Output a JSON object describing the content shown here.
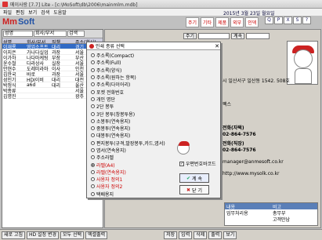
{
  "window": {
    "title": "메이사랑 [7.7] Lite - [c:\\MoSoft\\db\\2006\\mainmlm.mdb]"
  },
  "menu": [
    "파일",
    "편집",
    "보기",
    "검색",
    "도움말"
  ],
  "date_text": "2015년 3월 23일 월요일",
  "logo": {
    "mm": "Mm",
    "rest": "Soft"
  },
  "topnav": [
    "주기",
    "기타",
    "제품",
    "외부",
    "인덱"
  ],
  "toolbar_icons": [
    "Q",
    "P",
    "X",
    "S",
    "?"
  ],
  "left_panel": {
    "search_fields": [
      "성명",
      "회사/부서",
      "검색"
    ],
    "columns": [
      "성명",
      "회사/부서",
      "직책",
      "주소(회사)"
    ],
    "rows": [
      [
        "이재룡",
        "영업소프트",
        "대리",
        "경기"
      ],
      [
        "이지은",
        "가나다실업",
        "과장",
        "서울"
      ],
      [
        "이가하",
        "나다마케팅",
        "부장",
        "부산"
      ],
      [
        "윤수철",
        "다라상사",
        "실장",
        "서울"
      ],
      [
        "안현수",
        "도레미라마",
        "이사",
        "인천"
      ],
      [
        "김한국",
        "바로",
        "과장",
        "서울"
      ],
      [
        "성인기",
        "HDI이비",
        "대리",
        "대전"
      ],
      [
        "박정식",
        "a6d",
        "대리",
        "울산"
      ],
      [
        "박종류",
        "",
        "",
        "서울"
      ],
      [
        "김명진",
        "",
        "",
        "광주"
      ]
    ],
    "selected_row": 0
  },
  "right_panel": {
    "top_buttons": [
      "주기",
      "계속",
      "비고"
    ],
    "fax_label": "팩스",
    "phone_work_label": "전화(자택)",
    "phone_work_value": "02-864-7576",
    "phone_home_label": "전화(직장)",
    "phone_mobile_value": "02-864-7576",
    "address": "시 일산서구 일산동 1542. 508호",
    "email": "manager@anmesoft.co.kr",
    "homepage": "http://www.mysolk.co.kr",
    "memo_headers": [
      "내용",
      "비고"
    ],
    "memo_rows": [
      [
        "업무처리용",
        "총무부"
      ],
      [
        "",
        "고객만남"
      ]
    ]
  },
  "dialog": {
    "title": "인쇄 종류 선택",
    "options": [
      "주소록(Compact)",
      "주소록(Full)",
      "주소록(양식)",
      "주소록(원하는 항목)",
      "주소록(다이어리)",
      "포켓 전화번호",
      "개인 명단",
      "2단 봉투",
      "3단 봉투(창봉투용)",
      "소봉투(연속용지)",
      "중봉투(연속용지)",
      "대봉투(연속용지)",
      "편지봉투(규격,발장봉투,카드,엽서)",
      "엽서(연속용지)",
      "주소라벨",
      "라벨(A4)",
      "라벨(연속용지)",
      "사용자 정의1",
      "사용자 정의2",
      "택배용지"
    ],
    "checked_index": 15,
    "red_indices": [
      15,
      16,
      17,
      18
    ],
    "checkbox_label": "우편번호바코드",
    "ok_label": "계 속",
    "close_label": "닫 기"
  },
  "statusbar": [
    "새로 고침",
    "HD 설정 변경",
    "모두 선택",
    "엑셀출력",
    "저장",
    "입력",
    "삭제",
    "출력",
    "보기"
  ]
}
